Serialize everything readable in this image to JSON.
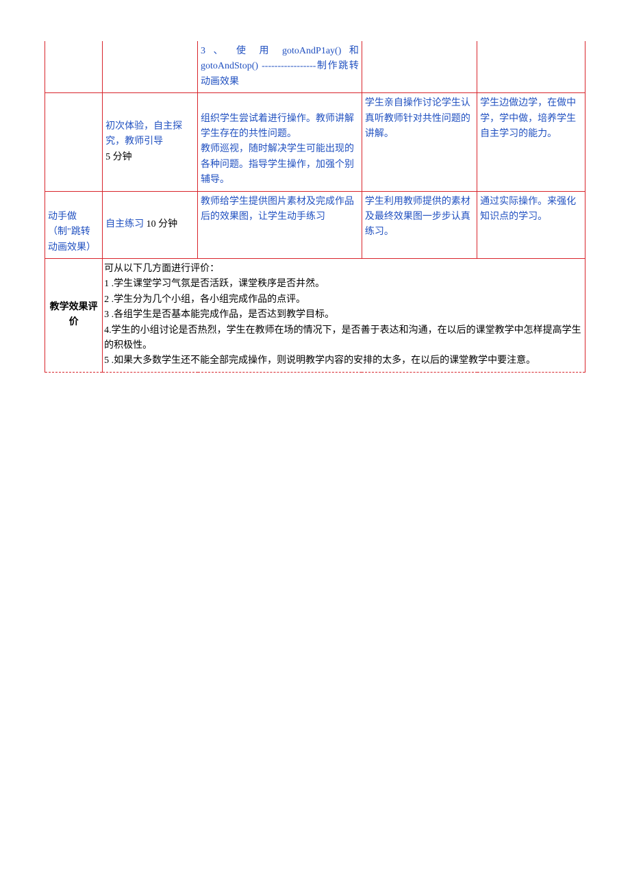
{
  "row1": {
    "col3": "3 、 使 用 gotoAndP1ay() 和gotoAndStop() -----------------制作跳转动画效果"
  },
  "row2": {
    "col2_blue": "初次体验，自主探究，教师引导",
    "col2_black": "5 分钟",
    "col3": "组织学生尝试着进行操作。教师讲解学生存在的共性问题。\n教师巡视，随时解决学生可能出现的各种问题。指导学生操作，加强个别辅导。",
    "col4": "学生亲自操作讨论学生认真听教师针对共性问题的讲解。",
    "col5": "学生边做边学，在做中学，学中做，培养学生自主学习的能力。"
  },
  "row3": {
    "col1": "  动手做\n（制\"跳转动画效果）",
    "col2_blue": "自主练习",
    "col2_black": " 10 分钟",
    "col3": "教师给学生提供图片素材及完成作品后的效果图，让学生动手练习",
    "col4": "学生利用教师提供的素材及最终效果图一步步认真练习。",
    "col5": "通过实际操作。来强化知识点的学习。"
  },
  "row4": {
    "col1": "教学效果评价",
    "content_intro": "可从以下几方面进行评价：",
    "item1_num": "1",
    "item1_text": "        .学生课堂学习气氛是否活跃，课堂秩序是否井然。",
    "item2_num": "2",
    "item2_text": "        .学生分为几个小组，各小组完成作品的点评。",
    "item3_num": "3",
    "item3_text": "        .各组学生是否基本能完成作品，是否达到教学目标。",
    "item4": "4.学生的小组讨论是否热烈，学生在教师在场的情况下，是否善于表达和沟通，在以后的课堂教学中怎样提高学生的积极性。",
    "item5_num": "5",
    "item5_text": "     .如果大多数学生还不能全部完成操作，则说明教学内容的安排的太多，在以后的课堂教学中要注意。"
  }
}
